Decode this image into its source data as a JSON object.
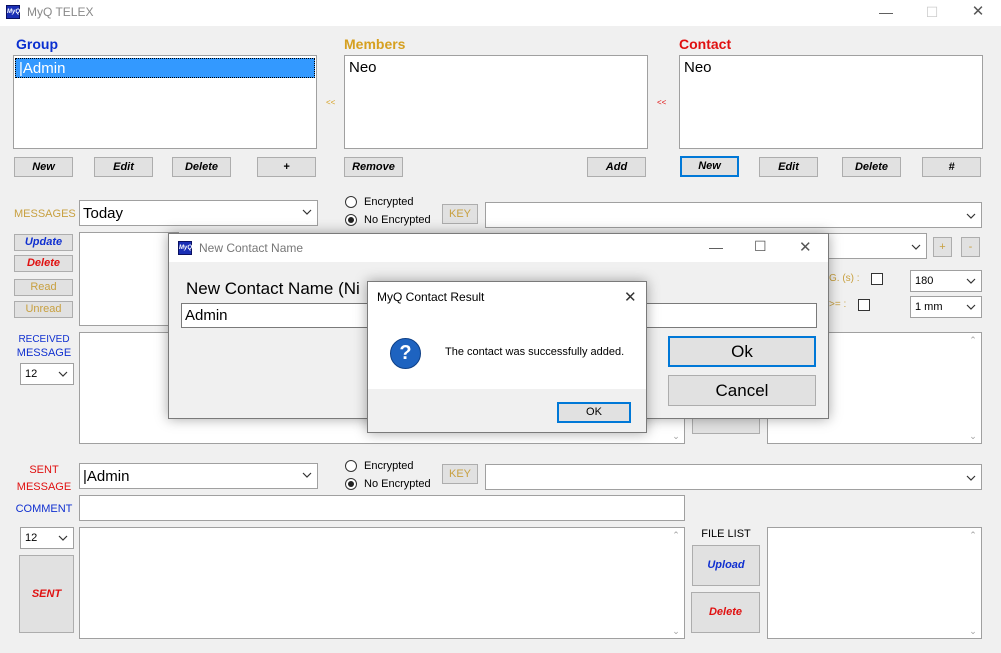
{
  "window": {
    "title": "MyQ TELEX",
    "app_icon": "MyQ",
    "minimize": "—",
    "maximize": "☐",
    "close": "✕"
  },
  "group": {
    "label": "Group",
    "label_color": "#0a2fd0",
    "items": [
      "|Admin"
    ],
    "buttons": {
      "new": "New",
      "edit": "Edit",
      "delete": "Delete",
      "plus": "+"
    }
  },
  "members": {
    "label": "Members",
    "label_color": "#d6a020",
    "items": [
      "Neo"
    ],
    "arrow": "<<",
    "buttons": {
      "remove": "Remove",
      "add": "Add"
    }
  },
  "contact": {
    "label": "Contact",
    "label_color": "#e01010",
    "items": [
      "Neo"
    ],
    "arrow": "<<",
    "buttons": {
      "new": "New",
      "edit": "Edit",
      "delete": "Delete",
      "hash": "#"
    }
  },
  "messages": {
    "label": "MESSAGES",
    "filter_value": "Today",
    "encrypted_label": "Encrypted",
    "no_encrypted_label": "No Encrypted",
    "key_label": "KEY",
    "buttons": {
      "update": "Update",
      "delete": "Delete",
      "read": "Read",
      "unread": "Unread"
    },
    "plus": "+",
    "minus": "-",
    "chk1_label": "G. (s) :",
    "chk2_label": ">= :",
    "sel1_value": "180",
    "sel2_value": "1 mm"
  },
  "received": {
    "label_line1": "RECEIVED",
    "label_line2": "MESSAGE",
    "font_size": "12"
  },
  "sent": {
    "label_line1": "SENT",
    "label_line2": "MESSAGE",
    "group_value": "|Admin",
    "encrypted_label": "Encrypted",
    "no_encrypted_label": "No Encrypted",
    "key_label": "KEY",
    "comment_label": "COMMENT",
    "font_size": "12",
    "sent_button": "SENT"
  },
  "files": {
    "label": "FILE LIST",
    "upload": "Upload",
    "delete": "Delete"
  },
  "new_contact_dialog": {
    "title": "New Contact Name",
    "prompt": "New Contact Name (Ni",
    "input_value": "Admin",
    "ok": "Ok",
    "cancel": "Cancel"
  },
  "result_dialog": {
    "title": "MyQ Contact Result",
    "message": "The contact was successfully added.",
    "ok": "OK",
    "icon": "?"
  }
}
